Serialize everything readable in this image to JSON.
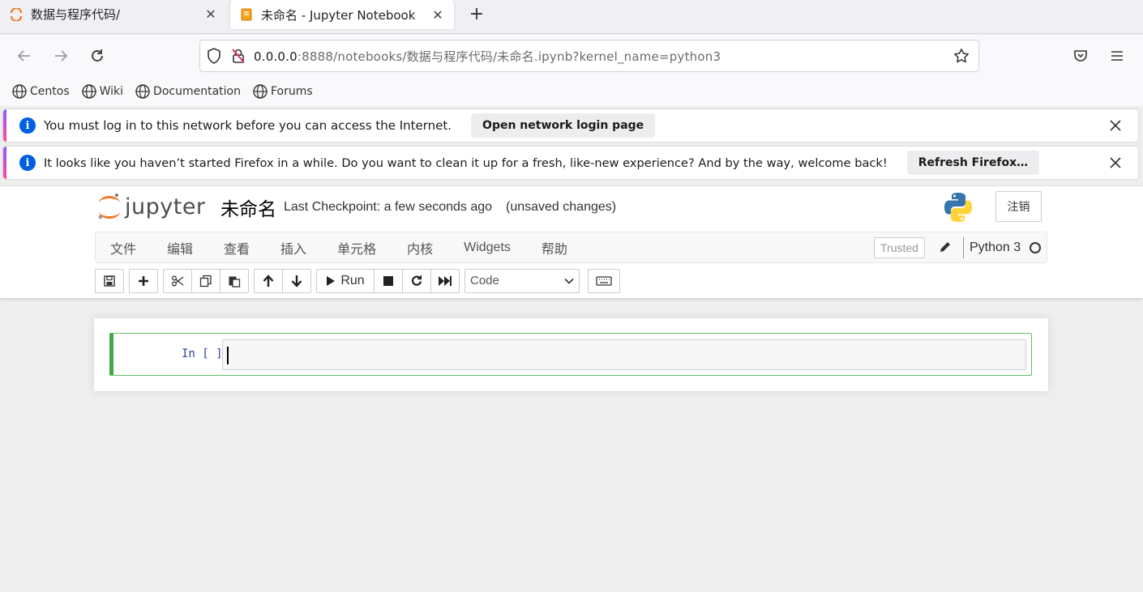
{
  "browser": {
    "tabs": [
      {
        "title": "数据与程序代码/",
        "icon": "jupyter-spinner-icon",
        "active": false
      },
      {
        "title": "未命名 - Jupyter Notebook",
        "icon": "notebook-icon",
        "active": true
      }
    ],
    "url_host": "0.0.0.0",
    "url_rest": ":8888/notebooks/数据与程序代码/未命名.ipynb?kernel_name=python3",
    "bookmarks": [
      "Centos",
      "Wiki",
      "Documentation",
      "Forums"
    ]
  },
  "notifications": [
    {
      "text": "You must log in to this network before you can access the Internet.",
      "button": "Open network login page"
    },
    {
      "text": "It looks like you haven’t started Firefox in a while. Do you want to clean it up for a fresh, like-new experience? And by the way, welcome back!",
      "button": "Refresh Firefox…"
    }
  ],
  "jupyter": {
    "logo_text": "jupyter",
    "notebook_name": "未命名",
    "checkpoint": "Last Checkpoint: a few seconds ago",
    "unsaved": "(unsaved changes)",
    "logout_label": "注销",
    "menus": [
      "文件",
      "编辑",
      "查看",
      "插入",
      "单元格",
      "内核",
      "Widgets",
      "帮助"
    ],
    "trusted": "Trusted",
    "kernel": "Python 3",
    "run_label": "Run",
    "cell_type": "Code",
    "prompt": "In [ ]:"
  }
}
